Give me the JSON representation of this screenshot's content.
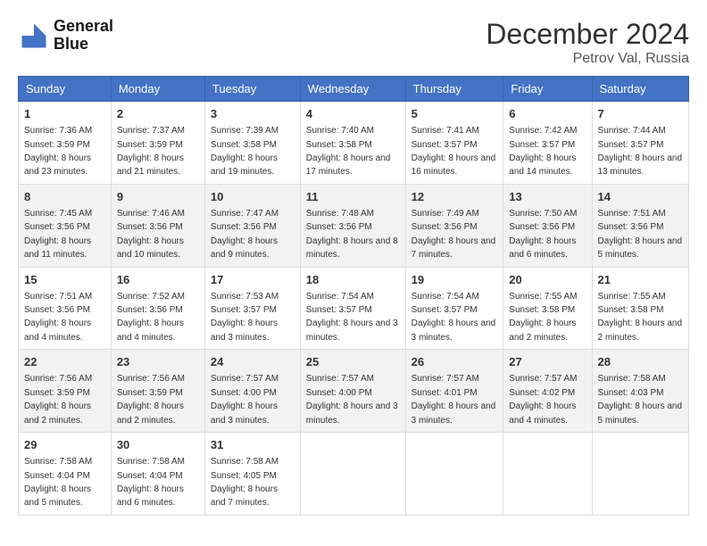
{
  "header": {
    "logo_line1": "General",
    "logo_line2": "Blue",
    "month": "December 2024",
    "location": "Petrov Val, Russia"
  },
  "weekdays": [
    "Sunday",
    "Monday",
    "Tuesday",
    "Wednesday",
    "Thursday",
    "Friday",
    "Saturday"
  ],
  "weeks": [
    [
      {
        "day": "1",
        "sunrise": "7:36 AM",
        "sunset": "3:59 PM",
        "daylight": "8 hours and 23 minutes."
      },
      {
        "day": "2",
        "sunrise": "7:37 AM",
        "sunset": "3:59 PM",
        "daylight": "8 hours and 21 minutes."
      },
      {
        "day": "3",
        "sunrise": "7:39 AM",
        "sunset": "3:58 PM",
        "daylight": "8 hours and 19 minutes."
      },
      {
        "day": "4",
        "sunrise": "7:40 AM",
        "sunset": "3:58 PM",
        "daylight": "8 hours and 17 minutes."
      },
      {
        "day": "5",
        "sunrise": "7:41 AM",
        "sunset": "3:57 PM",
        "daylight": "8 hours and 16 minutes."
      },
      {
        "day": "6",
        "sunrise": "7:42 AM",
        "sunset": "3:57 PM",
        "daylight": "8 hours and 14 minutes."
      },
      {
        "day": "7",
        "sunrise": "7:44 AM",
        "sunset": "3:57 PM",
        "daylight": "8 hours and 13 minutes."
      }
    ],
    [
      {
        "day": "8",
        "sunrise": "7:45 AM",
        "sunset": "3:56 PM",
        "daylight": "8 hours and 11 minutes."
      },
      {
        "day": "9",
        "sunrise": "7:46 AM",
        "sunset": "3:56 PM",
        "daylight": "8 hours and 10 minutes."
      },
      {
        "day": "10",
        "sunrise": "7:47 AM",
        "sunset": "3:56 PM",
        "daylight": "8 hours and 9 minutes."
      },
      {
        "day": "11",
        "sunrise": "7:48 AM",
        "sunset": "3:56 PM",
        "daylight": "8 hours and 8 minutes."
      },
      {
        "day": "12",
        "sunrise": "7:49 AM",
        "sunset": "3:56 PM",
        "daylight": "8 hours and 7 minutes."
      },
      {
        "day": "13",
        "sunrise": "7:50 AM",
        "sunset": "3:56 PM",
        "daylight": "8 hours and 6 minutes."
      },
      {
        "day": "14",
        "sunrise": "7:51 AM",
        "sunset": "3:56 PM",
        "daylight": "8 hours and 5 minutes."
      }
    ],
    [
      {
        "day": "15",
        "sunrise": "7:51 AM",
        "sunset": "3:56 PM",
        "daylight": "8 hours and 4 minutes."
      },
      {
        "day": "16",
        "sunrise": "7:52 AM",
        "sunset": "3:56 PM",
        "daylight": "8 hours and 4 minutes."
      },
      {
        "day": "17",
        "sunrise": "7:53 AM",
        "sunset": "3:57 PM",
        "daylight": "8 hours and 3 minutes."
      },
      {
        "day": "18",
        "sunrise": "7:54 AM",
        "sunset": "3:57 PM",
        "daylight": "8 hours and 3 minutes."
      },
      {
        "day": "19",
        "sunrise": "7:54 AM",
        "sunset": "3:57 PM",
        "daylight": "8 hours and 3 minutes."
      },
      {
        "day": "20",
        "sunrise": "7:55 AM",
        "sunset": "3:58 PM",
        "daylight": "8 hours and 2 minutes."
      },
      {
        "day": "21",
        "sunrise": "7:55 AM",
        "sunset": "3:58 PM",
        "daylight": "8 hours and 2 minutes."
      }
    ],
    [
      {
        "day": "22",
        "sunrise": "7:56 AM",
        "sunset": "3:59 PM",
        "daylight": "8 hours and 2 minutes."
      },
      {
        "day": "23",
        "sunrise": "7:56 AM",
        "sunset": "3:59 PM",
        "daylight": "8 hours and 2 minutes."
      },
      {
        "day": "24",
        "sunrise": "7:57 AM",
        "sunset": "4:00 PM",
        "daylight": "8 hours and 3 minutes."
      },
      {
        "day": "25",
        "sunrise": "7:57 AM",
        "sunset": "4:00 PM",
        "daylight": "8 hours and 3 minutes."
      },
      {
        "day": "26",
        "sunrise": "7:57 AM",
        "sunset": "4:01 PM",
        "daylight": "8 hours and 3 minutes."
      },
      {
        "day": "27",
        "sunrise": "7:57 AM",
        "sunset": "4:02 PM",
        "daylight": "8 hours and 4 minutes."
      },
      {
        "day": "28",
        "sunrise": "7:58 AM",
        "sunset": "4:03 PM",
        "daylight": "8 hours and 5 minutes."
      }
    ],
    [
      {
        "day": "29",
        "sunrise": "7:58 AM",
        "sunset": "4:04 PM",
        "daylight": "8 hours and 5 minutes."
      },
      {
        "day": "30",
        "sunrise": "7:58 AM",
        "sunset": "4:04 PM",
        "daylight": "8 hours and 6 minutes."
      },
      {
        "day": "31",
        "sunrise": "7:58 AM",
        "sunset": "4:05 PM",
        "daylight": "8 hours and 7 minutes."
      },
      null,
      null,
      null,
      null
    ]
  ]
}
